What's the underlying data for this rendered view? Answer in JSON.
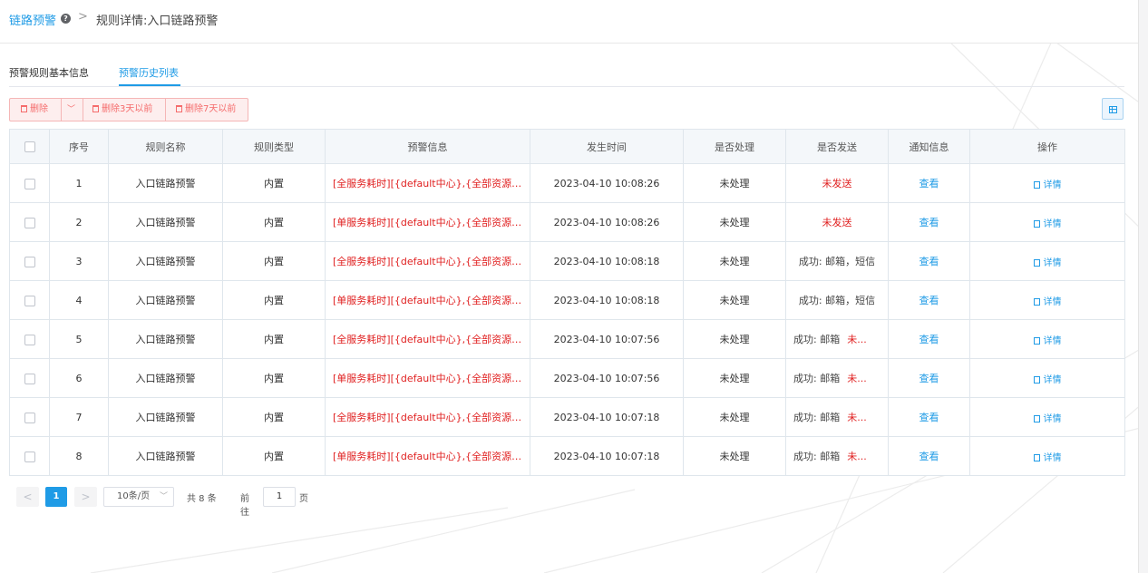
{
  "breadcrumb": {
    "root": "链路预警",
    "help_icon": "question-circle-icon",
    "separator": ">",
    "current": "规则详情:入口链路预警"
  },
  "tabs": [
    {
      "label": "预警规则基本信息",
      "active": false
    },
    {
      "label": "预警历史列表",
      "active": true
    }
  ],
  "toolbar": {
    "delete_label": "删除",
    "delete3_label": "删除3天以前",
    "delete7_label": "删除7天以前",
    "dropdown_icon": "chevron-down-icon",
    "column_settings_icon": "table-grid-icon"
  },
  "table": {
    "columns": [
      "序号",
      "规则名称",
      "规则类型",
      "预警信息",
      "发生时间",
      "是否处理",
      "是否发送",
      "通知信息",
      "操作"
    ],
    "rows": [
      {
        "seq": "1",
        "name": "入口链路预警",
        "type": "内置",
        "info": "[全服务耗时][{default中心},{全部资源-gateway}]",
        "time": "2023-04-10 10:08:26",
        "handled": "未处理",
        "sent": "未发送",
        "sent_fail": "",
        "notify": "查看",
        "action": "详情"
      },
      {
        "seq": "2",
        "name": "入口链路预警",
        "type": "内置",
        "info": "[单服务耗时][{default中心},{全部资源-gateway}]",
        "time": "2023-04-10 10:08:26",
        "handled": "未处理",
        "sent": "未发送",
        "sent_fail": "",
        "notify": "查看",
        "action": "详情"
      },
      {
        "seq": "3",
        "name": "入口链路预警",
        "type": "内置",
        "info": "[全服务耗时][{default中心},{全部资源-gateway}]",
        "time": "2023-04-10 10:08:18",
        "handled": "未处理",
        "sent": "成功: 邮箱，短信",
        "sent_fail": "",
        "notify": "查看",
        "action": "详情"
      },
      {
        "seq": "4",
        "name": "入口链路预警",
        "type": "内置",
        "info": "[单服务耗时][{default中心},{全部资源-gateway}]",
        "time": "2023-04-10 10:08:18",
        "handled": "未处理",
        "sent": "成功: 邮箱，短信",
        "sent_fail": "",
        "notify": "查看",
        "action": "详情"
      },
      {
        "seq": "5",
        "name": "入口链路预警",
        "type": "内置",
        "info": "[全服务耗时][{default中心},{全部资源-web}]",
        "time": "2023-04-10 10:07:56",
        "handled": "未处理",
        "sent": "成功: 邮箱",
        "sent_fail": "未...",
        "notify": "查看",
        "action": "详情"
      },
      {
        "seq": "6",
        "name": "入口链路预警",
        "type": "内置",
        "info": "[单服务耗时][{default中心},{全部资源-web}]",
        "time": "2023-04-10 10:07:56",
        "handled": "未处理",
        "sent": "成功: 邮箱",
        "sent_fail": "未...",
        "notify": "查看",
        "action": "详情"
      },
      {
        "seq": "7",
        "name": "入口链路预警",
        "type": "内置",
        "info": "[全服务耗时][{default中心},{全部资源-gateway}]",
        "time": "2023-04-10 10:07:18",
        "handled": "未处理",
        "sent": "成功: 邮箱",
        "sent_fail": "未...",
        "notify": "查看",
        "action": "详情"
      },
      {
        "seq": "8",
        "name": "入口链路预警",
        "type": "内置",
        "info": "[单服务耗时][{default中心},{全部资源-gateway}]",
        "time": "2023-04-10 10:07:18",
        "handled": "未处理",
        "sent": "成功: 邮箱",
        "sent_fail": "未...",
        "notify": "查看",
        "action": "详情"
      }
    ]
  },
  "pagination": {
    "prev": "<",
    "current_page": "1",
    "next": ">",
    "page_size": "10条/页",
    "total": "共 8 条",
    "goto_label": "前往",
    "goto_value": "1",
    "page_label": "页"
  },
  "colors": {
    "accent": "#1f9be6",
    "danger": "#e02020",
    "header_bg": "#f4f7fa"
  }
}
